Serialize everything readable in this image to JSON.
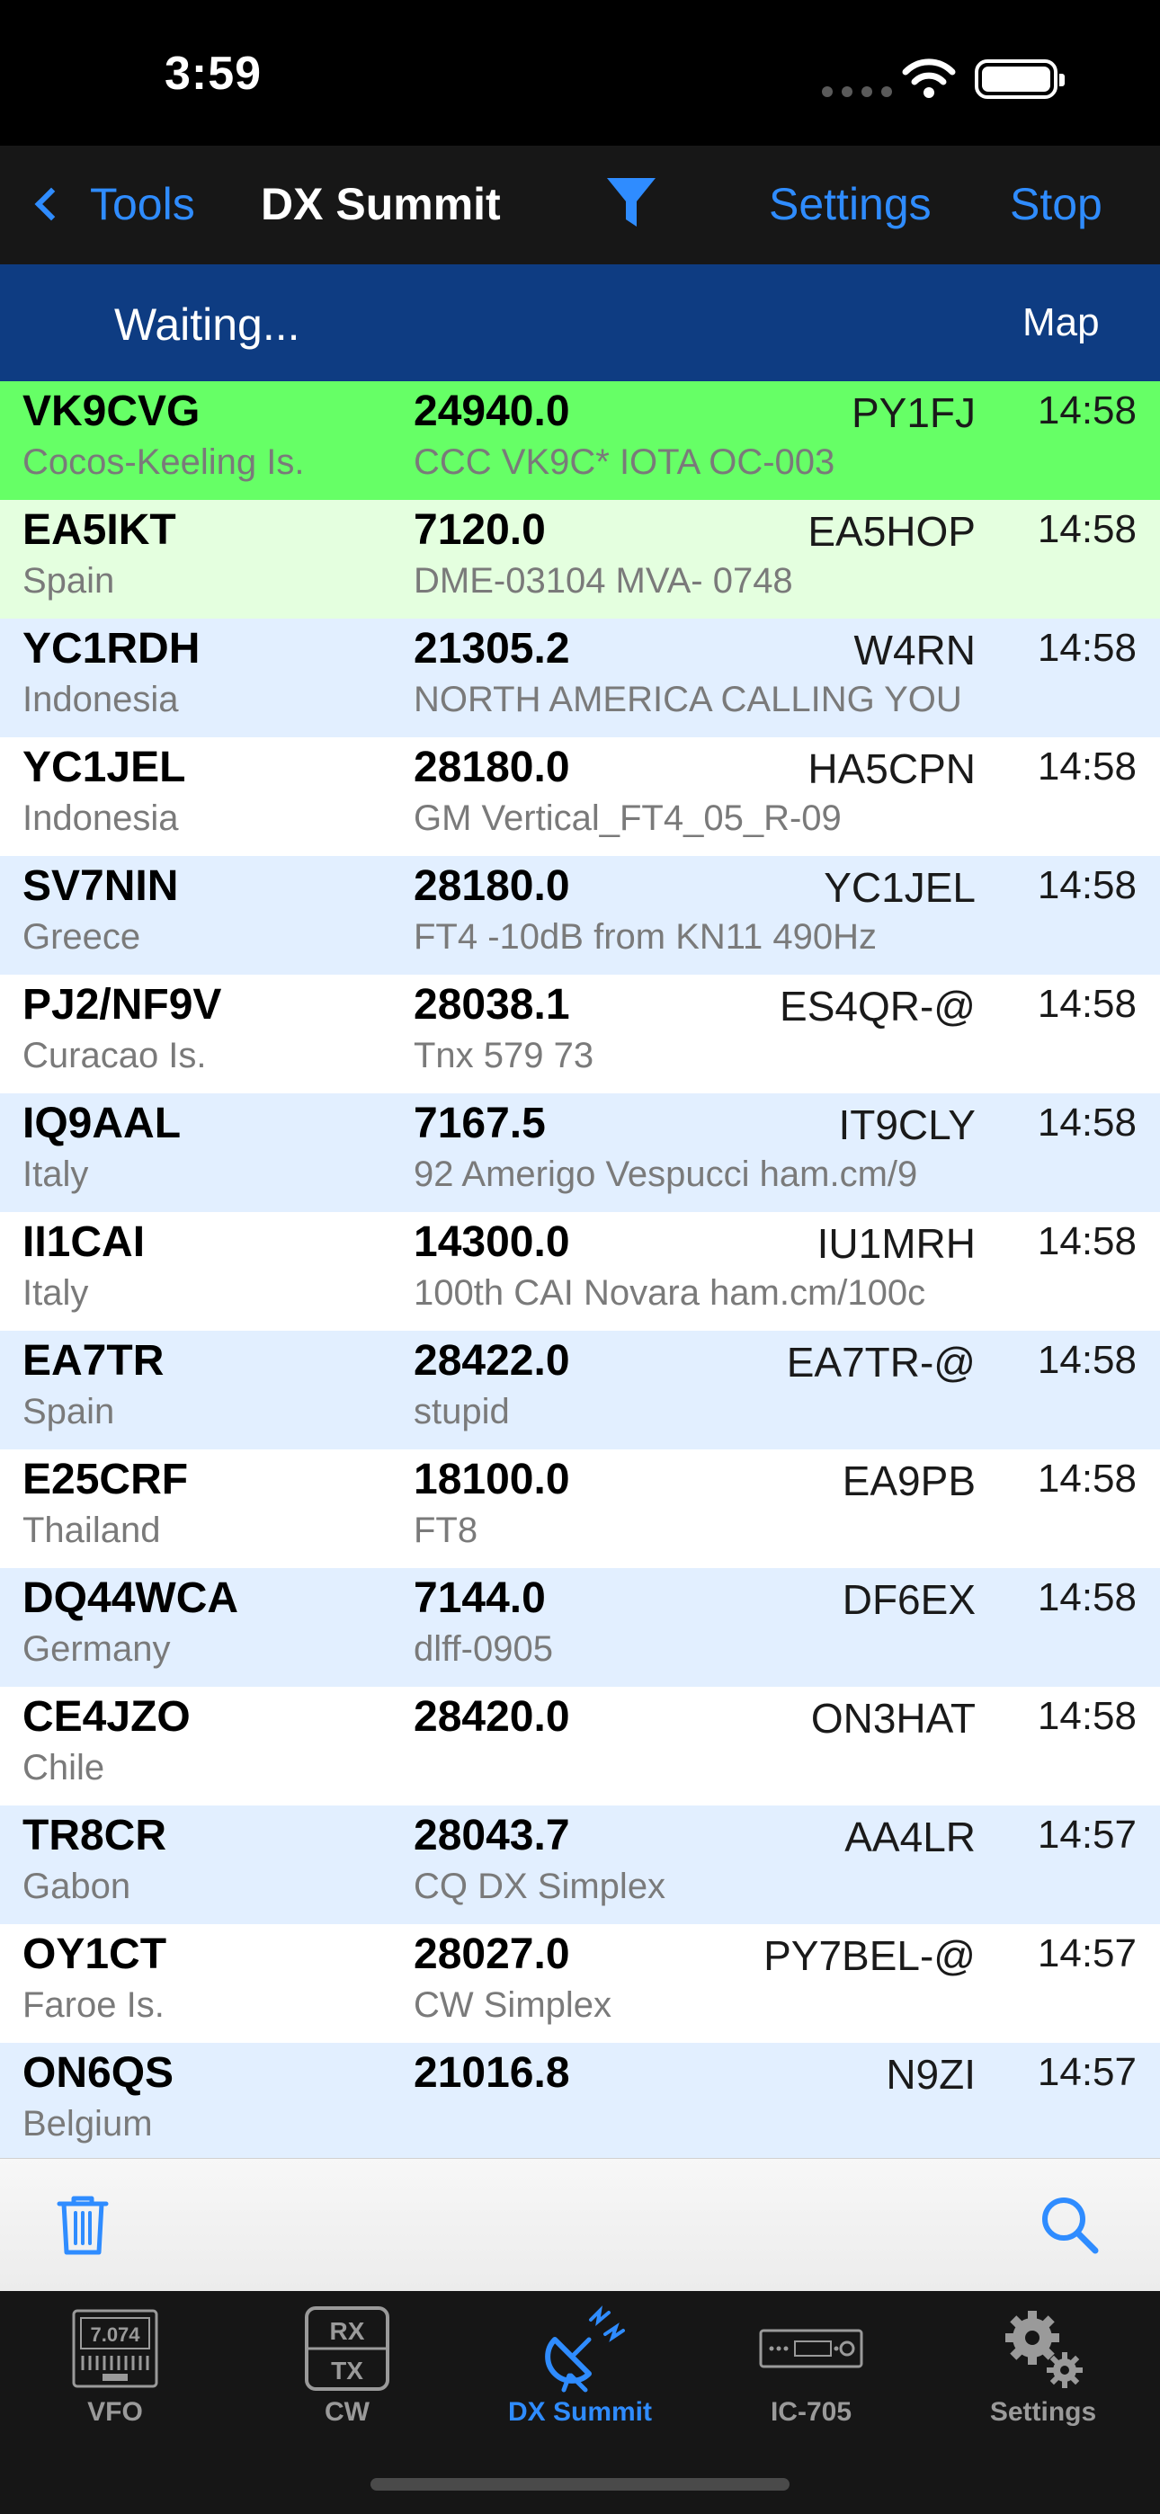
{
  "status_bar": {
    "time": "3:59"
  },
  "nav": {
    "back_label": "Tools",
    "title": "DX Summit",
    "settings_label": "Settings",
    "stop_label": "Stop"
  },
  "strip": {
    "status": "Waiting...",
    "map_label": "Map"
  },
  "colors": {
    "accent": "#2f8cff",
    "strip_bg": "#0e3c82",
    "row_highlight": "#66ff66",
    "row_light_green": "#e4ffdf",
    "row_light_blue": "#e2efff",
    "row_white": "#ffffff"
  },
  "spots": [
    {
      "call": "VK9CVG",
      "country": "Cocos-Keeling Is.",
      "freq": "24940.0",
      "comment": "CCC VK9C* IOTA OC-003",
      "spotter": "PY1FJ",
      "time": "14:58",
      "bg": "#66ff66"
    },
    {
      "call": "EA5IKT",
      "country": "Spain",
      "freq": "7120.0",
      "comment": "DME-03104 MVA- 0748",
      "spotter": "EA5HOP",
      "time": "14:58",
      "bg": "#e4ffdf"
    },
    {
      "call": "YC1RDH",
      "country": "Indonesia",
      "freq": "21305.2",
      "comment": "NORTH AMERICA CALLING YOU",
      "spotter": "W4RN",
      "time": "14:58",
      "bg": "#e2efff"
    },
    {
      "call": "YC1JEL",
      "country": "Indonesia",
      "freq": "28180.0",
      "comment": "GM Vertical_FT4_05_R-09",
      "spotter": "HA5CPN",
      "time": "14:58",
      "bg": "#ffffff"
    },
    {
      "call": "SV7NIN",
      "country": "Greece",
      "freq": "28180.0",
      "comment": "FT4 -10dB from KN11 490Hz",
      "spotter": "YC1JEL",
      "time": "14:58",
      "bg": "#e2efff"
    },
    {
      "call": "PJ2/NF9V",
      "country": "Curacao Is.",
      "freq": "28038.1",
      "comment": "Tnx 579 73",
      "spotter": "ES4QR-@",
      "time": "14:58",
      "bg": "#ffffff"
    },
    {
      "call": "IQ9AAL",
      "country": "Italy",
      "freq": "7167.5",
      "comment": "92 Amerigo Vespucci ham.cm/9",
      "spotter": "IT9CLY",
      "time": "14:58",
      "bg": "#e2efff"
    },
    {
      "call": "II1CAI",
      "country": "Italy",
      "freq": "14300.0",
      "comment": "100th CAI Novara ham.cm/100c",
      "spotter": "IU1MRH",
      "time": "14:58",
      "bg": "#ffffff"
    },
    {
      "call": "EA7TR",
      "country": "Spain",
      "freq": "28422.0",
      "comment": "stupid",
      "spotter": "EA7TR-@",
      "time": "14:58",
      "bg": "#e2efff"
    },
    {
      "call": "E25CRF",
      "country": "Thailand",
      "freq": "18100.0",
      "comment": "FT8",
      "spotter": "EA9PB",
      "time": "14:58",
      "bg": "#ffffff"
    },
    {
      "call": "DQ44WCA",
      "country": "Germany",
      "freq": "7144.0",
      "comment": "dlff-0905",
      "spotter": "DF6EX",
      "time": "14:58",
      "bg": "#e2efff"
    },
    {
      "call": "CE4JZO",
      "country": "Chile",
      "freq": "28420.0",
      "comment": "",
      "spotter": "ON3HAT",
      "time": "14:58",
      "bg": "#ffffff"
    },
    {
      "call": "TR8CR",
      "country": "Gabon",
      "freq": "28043.7",
      "comment": "CQ DX Simplex",
      "spotter": "AA4LR",
      "time": "14:57",
      "bg": "#e2efff"
    },
    {
      "call": "OY1CT",
      "country": "Faroe Is.",
      "freq": "28027.0",
      "comment": "CW Simplex",
      "spotter": "PY7BEL-@",
      "time": "14:57",
      "bg": "#ffffff"
    },
    {
      "call": "ON6QS",
      "country": "Belgium",
      "freq": "21016.8",
      "comment": "",
      "spotter": "N9ZI",
      "time": "14:57",
      "bg": "#e2efff"
    }
  ],
  "toolbar": {
    "left_icon": "trash-icon",
    "right_icon": "search-icon"
  },
  "tabs": [
    {
      "label": "VFO",
      "icon": "vfo-display-icon",
      "display_value": "7.074",
      "active": false
    },
    {
      "label": "CW",
      "icon": "rx-tx-icon",
      "rx": "RX",
      "tx": "TX",
      "active": false
    },
    {
      "label": "DX Summit",
      "icon": "satellite-dish-icon",
      "active": true
    },
    {
      "label": "IC-705",
      "icon": "radio-icon",
      "active": false
    },
    {
      "label": "Settings",
      "icon": "gears-icon",
      "active": false
    }
  ]
}
